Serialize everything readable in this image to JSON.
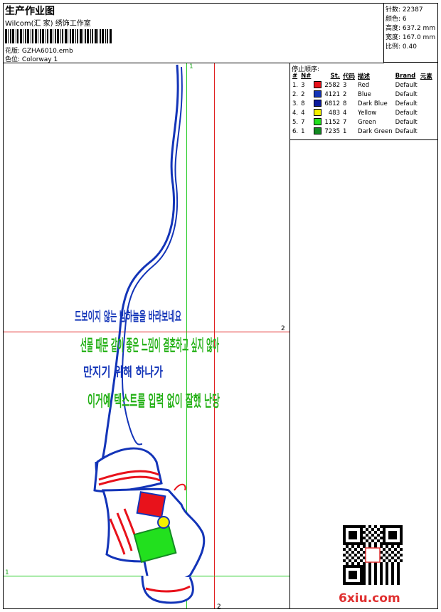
{
  "header": {
    "title": "生产作业图",
    "company": "Wilcom(汇 家) 绣饰工作室",
    "design_label": "花版:",
    "design_file": "GZHA6010.emb",
    "colorway_label": "色位:",
    "colorway": "Colorway 1"
  },
  "stats": [
    {
      "label": "针数:",
      "value": "22387"
    },
    {
      "label": "颜色:",
      "value": "6"
    },
    {
      "label": "高度:",
      "value": "637.2 mm"
    },
    {
      "label": "宽度:",
      "value": "167.0 mm"
    },
    {
      "label": "比例:",
      "value": "0.40"
    }
  ],
  "sequence": {
    "title": "停止顺序:",
    "columns": [
      "#",
      "N#",
      "St.",
      "代码",
      "描述",
      "Brand",
      "元素"
    ],
    "rows": [
      {
        "idx": "1.",
        "n": "3",
        "color": "#e8121b",
        "st": "2582",
        "code": "3",
        "desc": "Red",
        "brand": "Default"
      },
      {
        "idx": "2.",
        "n": "2",
        "color": "#1334b8",
        "st": "4121",
        "code": "2",
        "desc": "Blue",
        "brand": "Default"
      },
      {
        "idx": "3.",
        "n": "8",
        "color": "#0b1a9c",
        "st": "6812",
        "code": "8",
        "desc": "Dark Blue",
        "brand": "Default"
      },
      {
        "idx": "4.",
        "n": "4",
        "color": "#f4f000",
        "st": "483",
        "code": "4",
        "desc": "Yellow",
        "brand": "Default"
      },
      {
        "idx": "5.",
        "n": "7",
        "color": "#22e01e",
        "st": "1152",
        "code": "7",
        "desc": "Green",
        "brand": "Default"
      },
      {
        "idx": "6.",
        "n": "1",
        "color": "#138a22",
        "st": "7235",
        "code": "1",
        "desc": "Dark Green",
        "brand": "Default"
      }
    ]
  },
  "guides": {
    "v1": "1",
    "v2": "2",
    "h1": "1",
    "h2": "2"
  },
  "design_text": {
    "line1": "드보이지 않는 밤하늘을 바라보네요",
    "line2": "선물 때문 같이 좋은 느낌이 결혼하고 싶지 않아",
    "line3": "만지기 위해 하나가",
    "line4": "이거예 텍스트를 입력 없이 잘했 난당"
  },
  "watermark": "6xiu.com",
  "colors": {
    "red": "#e8121b",
    "blue": "#1334b8",
    "green": "#22b014",
    "darkgreen": "#138a22"
  }
}
